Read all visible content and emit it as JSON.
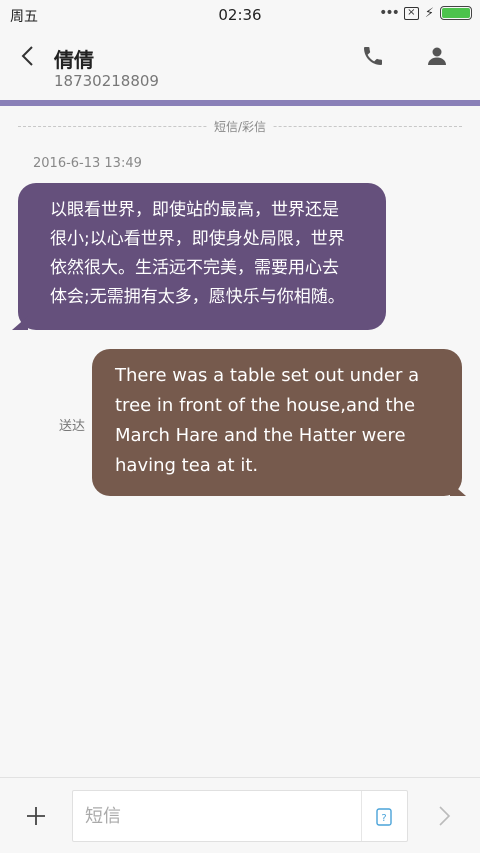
{
  "status_bar": {
    "day": "周五",
    "time": "02:36",
    "icons": [
      "more-dots-icon",
      "sim-x-icon",
      "charging-bolt-icon",
      "battery-icon"
    ],
    "battery_level": 1.0
  },
  "header": {
    "contact_name": "倩倩",
    "contact_number": "18730218809",
    "icons": [
      "back-arrow-icon",
      "phone-icon",
      "person-icon"
    ]
  },
  "conversation": {
    "divider_label": "短信/彩信",
    "timestamp": "2016-6-13 13:49",
    "incoming": {
      "lines": [
        "以眼看世界，即使站的最高，世界还是",
        "很小;以心看世界，即使身处局限，世界",
        "依然很大。生活远不完美，需要用心去",
        "体会;无需拥有太多，愿快乐与你相随。"
      ]
    },
    "outgoing": {
      "lines": [
        "There was a table set out under a",
        "tree in front of the house,and the",
        "March Hare and the Hatter were",
        "having tea at it."
      ],
      "status": "送达"
    }
  },
  "composer": {
    "placeholder": "短信",
    "value": "",
    "icons": [
      "plus-icon",
      "template-icon",
      "send-arrow-icon"
    ]
  },
  "colors": {
    "accent": "#8a80b8",
    "incoming_bubble": "#65507c",
    "outgoing_bubble": "#765a4d",
    "battery": "#4cc34c"
  }
}
